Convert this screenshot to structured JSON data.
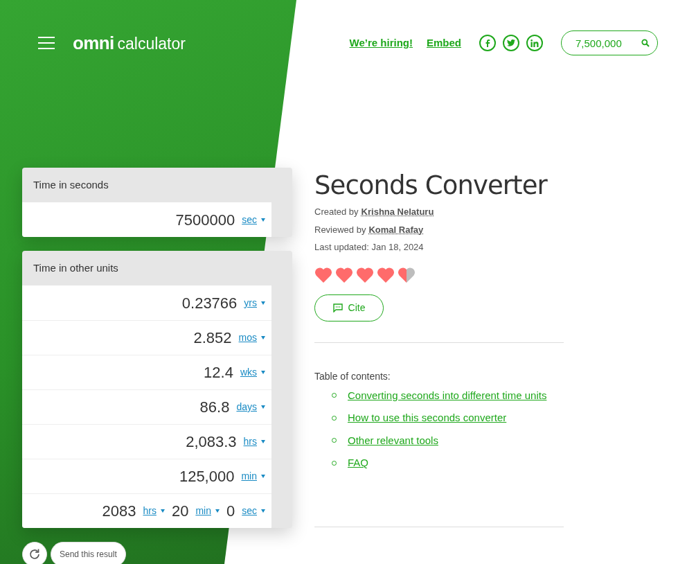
{
  "header": {
    "logo_mark": "omni",
    "logo_word": "calculator",
    "links": [
      "We’re hiring!",
      "Embed"
    ],
    "search": {
      "value": "7,500,000"
    }
  },
  "input_card": {
    "title": "Time in seconds",
    "rows": [
      {
        "parts": [
          {
            "value": "7500000",
            "unit": "sec"
          }
        ]
      }
    ]
  },
  "output_card": {
    "title": "Time in other units",
    "rows": [
      {
        "parts": [
          {
            "value": "0.23766",
            "unit": "yrs"
          }
        ]
      },
      {
        "parts": [
          {
            "value": "2.852",
            "unit": "mos"
          }
        ]
      },
      {
        "parts": [
          {
            "value": "12.4",
            "unit": "wks"
          }
        ]
      },
      {
        "parts": [
          {
            "value": "86.8",
            "unit": "days"
          }
        ]
      },
      {
        "parts": [
          {
            "value": "2,083.3",
            "unit": "hrs"
          }
        ]
      },
      {
        "parts": [
          {
            "value": "125,000",
            "unit": "min"
          }
        ]
      },
      {
        "parts": [
          {
            "value": "2083",
            "unit": "hrs"
          },
          {
            "value": "20",
            "unit": "min"
          },
          {
            "value": "0",
            "unit": "sec"
          }
        ]
      }
    ]
  },
  "actions": {
    "send": "Send this result"
  },
  "article": {
    "title": "Seconds Converter",
    "credits": [
      {
        "label": "Created by",
        "name": "Krishna Nelaturu"
      },
      {
        "label": "Reviewed by",
        "name": "Komal Rafay"
      }
    ],
    "updated": "Last updated: Jan 18, 2024",
    "stars": 4.5,
    "cite": "Cite",
    "toc": {
      "heading": "Table of contents:",
      "items": [
        "Converting seconds into different time units",
        "How to use this seconds converter",
        "Other relevant tools",
        "FAQ"
      ]
    }
  }
}
